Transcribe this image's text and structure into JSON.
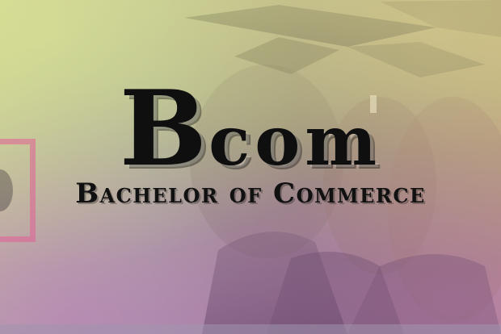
{
  "hero": {
    "title_initial": "B",
    "title_rest": "com",
    "subtitle": "Bachelor of Commerce"
  },
  "icons": {
    "background_image": "graduation-ceremony-photo"
  },
  "colors": {
    "title_text": "#0f0f0f",
    "frame_accent": "#e15f96"
  }
}
